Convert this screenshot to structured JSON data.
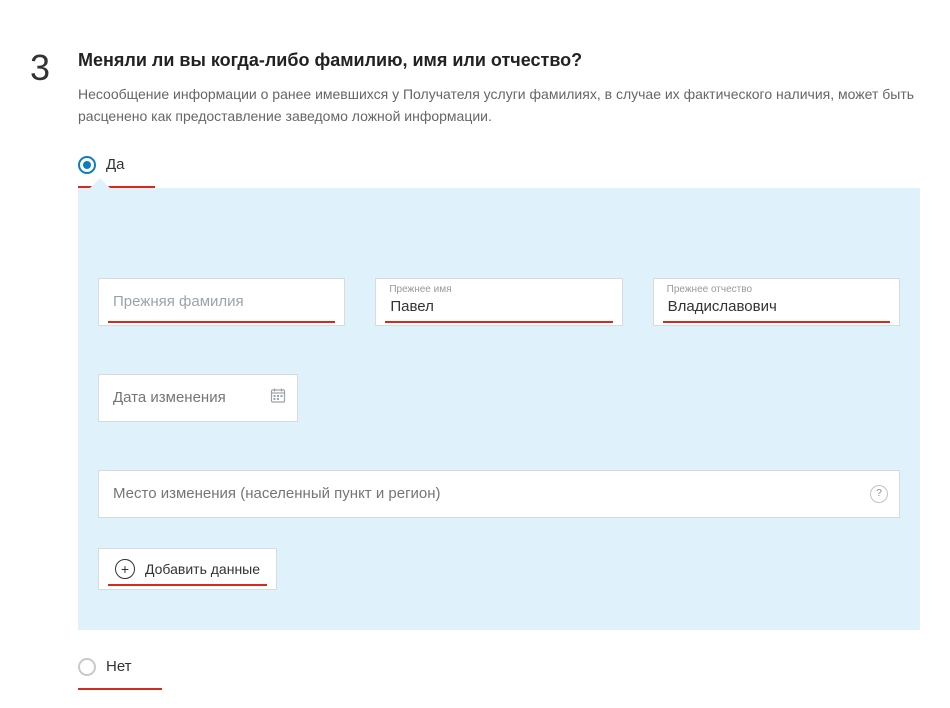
{
  "step": "3",
  "question": {
    "title": "Меняли ли вы когда-либо фамилию, имя или отчество?",
    "description": "Несообщение информации о ранее имевшихся у Получателя услуги фамилиях, в случае их фактического наличия, может быть расценено как предоставление заведомо ложной информации."
  },
  "options": {
    "yes": "Да",
    "no": "Нет"
  },
  "fields": {
    "surname": {
      "label": "",
      "placeholder": "Прежняя фамилия",
      "value": ""
    },
    "name": {
      "label": "Прежнее имя",
      "value": "Павел"
    },
    "patronymic": {
      "label": "Прежнее отчество",
      "value": "Владиславович"
    },
    "date": {
      "placeholder": "Дата изменения",
      "value": ""
    },
    "place": {
      "placeholder": "Место изменения (населенный пункт и регион)",
      "value": ""
    }
  },
  "addButton": "Добавить данные"
}
